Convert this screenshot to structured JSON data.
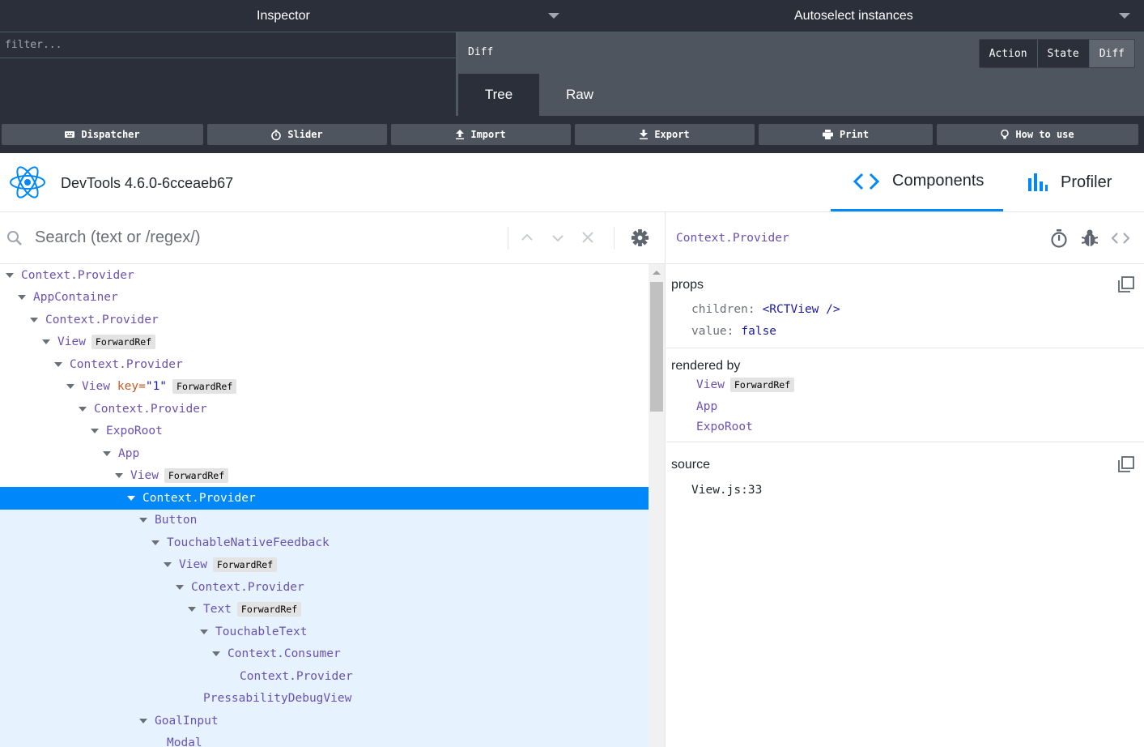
{
  "redux": {
    "monitor_left": "Inspector",
    "monitor_right": "Autoselect instances",
    "filter_placeholder": "filter...",
    "panel_title": "Diff",
    "tabs": [
      {
        "label": "Action",
        "active": false
      },
      {
        "label": "State",
        "active": false
      },
      {
        "label": "Diff",
        "active": true
      }
    ],
    "subtabs": [
      {
        "label": "Tree",
        "active": true
      },
      {
        "label": "Raw",
        "active": false
      }
    ],
    "buttons": [
      {
        "label": "Dispatcher",
        "icon": "keyboard-icon"
      },
      {
        "label": "Slider",
        "icon": "stopwatch-icon"
      },
      {
        "label": "Import",
        "icon": "upload-icon"
      },
      {
        "label": "Export",
        "icon": "download-icon"
      },
      {
        "label": "Print",
        "icon": "printer-icon"
      },
      {
        "label": "How to use",
        "icon": "lightbulb-icon"
      }
    ]
  },
  "devtools": {
    "version": "DevTools 4.6.0-6cceaeb67",
    "tabs": [
      {
        "label": "Components",
        "active": true
      },
      {
        "label": "Profiler",
        "active": false
      }
    ],
    "search_placeholder": "Search (text or /regex/)",
    "tree": [
      {
        "name": "Context.Provider",
        "depth": 0,
        "arrow": true
      },
      {
        "name": "AppContainer",
        "depth": 1,
        "arrow": true
      },
      {
        "name": "Context.Provider",
        "depth": 2,
        "arrow": true
      },
      {
        "name": "View",
        "depth": 3,
        "arrow": true,
        "badge": "ForwardRef"
      },
      {
        "name": "Context.Provider",
        "depth": 4,
        "arrow": true
      },
      {
        "name": "View",
        "depth": 5,
        "arrow": true,
        "key": "key=",
        "keyval": "\"1\"",
        "badge": "ForwardRef"
      },
      {
        "name": "Context.Provider",
        "depth": 6,
        "arrow": true
      },
      {
        "name": "ExpoRoot",
        "depth": 7,
        "arrow": true
      },
      {
        "name": "App",
        "depth": 8,
        "arrow": true
      },
      {
        "name": "View",
        "depth": 9,
        "arrow": true,
        "badge": "ForwardRef"
      },
      {
        "name": "Context.Provider",
        "depth": 10,
        "arrow": true,
        "selected": true
      },
      {
        "name": "Button",
        "depth": 11,
        "arrow": true,
        "sub": true
      },
      {
        "name": "TouchableNativeFeedback",
        "depth": 12,
        "arrow": true,
        "sub": true
      },
      {
        "name": "View",
        "depth": 13,
        "arrow": true,
        "badge": "ForwardRef",
        "sub": true
      },
      {
        "name": "Context.Provider",
        "depth": 14,
        "arrow": true,
        "sub": true
      },
      {
        "name": "Text",
        "depth": 15,
        "arrow": true,
        "badge": "ForwardRef",
        "sub": true
      },
      {
        "name": "TouchableText",
        "depth": 16,
        "arrow": true,
        "sub": true
      },
      {
        "name": "Context.Consumer",
        "depth": 17,
        "arrow": true,
        "sub": true
      },
      {
        "name": "Context.Provider",
        "depth": 18,
        "arrow": false,
        "sub": true
      },
      {
        "name": "PressabilityDebugView",
        "depth": 15,
        "arrow": false,
        "sub": true
      },
      {
        "name": "GoalInput",
        "depth": 11,
        "arrow": true,
        "sub": true
      },
      {
        "name": "Modal",
        "depth": 12,
        "arrow": false,
        "sub": true
      }
    ],
    "inspected": {
      "title": "Context.Provider",
      "props_label": "props",
      "props": [
        {
          "key": "children:",
          "value": "<RCTView />"
        },
        {
          "key": "value:",
          "value": "false"
        }
      ],
      "rendered_by_label": "rendered by",
      "rendered_by": [
        {
          "name": "View",
          "badge": "ForwardRef"
        },
        {
          "name": "App"
        },
        {
          "name": "ExpoRoot"
        }
      ],
      "source_label": "source",
      "source": "View.js:33"
    }
  }
}
